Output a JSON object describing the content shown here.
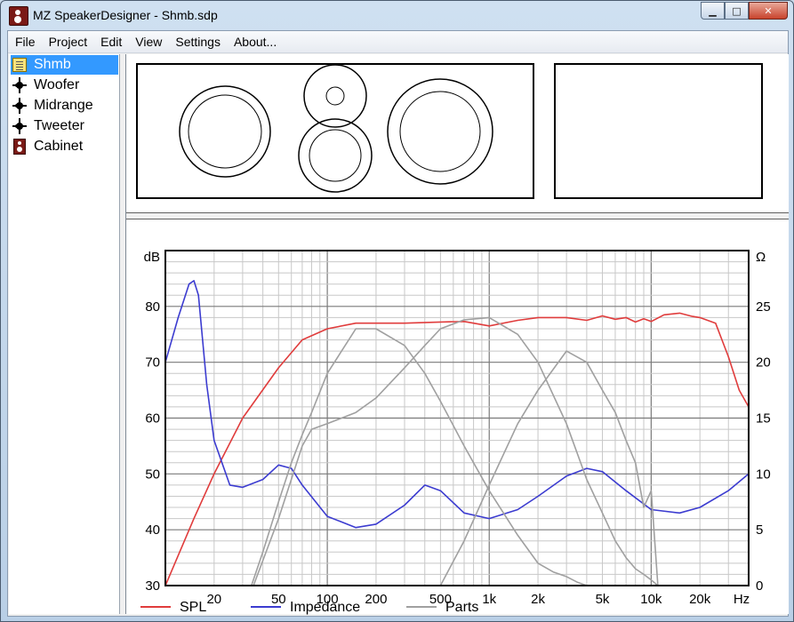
{
  "window": {
    "title": "MZ SpeakerDesigner - Shmb.sdp",
    "buttons": {
      "minimize": "▁",
      "maximize": "□",
      "close": "✕"
    }
  },
  "menu": [
    "File",
    "Project",
    "Edit",
    "View",
    "Settings",
    "About..."
  ],
  "tree": [
    {
      "label": "Shmb",
      "icon": "project-icon",
      "selected": true
    },
    {
      "label": "Woofer",
      "icon": "driver-icon",
      "selected": false
    },
    {
      "label": "Midrange",
      "icon": "driver-icon",
      "selected": false
    },
    {
      "label": "Tweeter",
      "icon": "driver-icon",
      "selected": false
    },
    {
      "label": "Cabinet",
      "icon": "cabinet-icon",
      "selected": false
    }
  ],
  "chart_data": {
    "type": "line",
    "x_scale": "log",
    "xlim": [
      10,
      40000
    ],
    "ylim_left": [
      30,
      90
    ],
    "ylim_right": [
      0,
      30
    ],
    "ylabel_left": "dB",
    "ylabel_right": "Ω",
    "xlabel": "Hz",
    "x_ticks": [
      {
        "value": 20,
        "label": "20"
      },
      {
        "value": 50,
        "label": "50"
      },
      {
        "value": 100,
        "label": "100"
      },
      {
        "value": 200,
        "label": "200"
      },
      {
        "value": 500,
        "label": "500"
      },
      {
        "value": 1000,
        "label": "1k"
      },
      {
        "value": 2000,
        "label": "2k"
      },
      {
        "value": 5000,
        "label": "5k"
      },
      {
        "value": 10000,
        "label": "10k"
      },
      {
        "value": 20000,
        "label": "20k"
      }
    ],
    "y_ticks_left": [
      30,
      40,
      50,
      60,
      70,
      80
    ],
    "y_ticks_right": [
      0,
      5,
      10,
      15,
      20,
      25
    ],
    "grid": true,
    "legend": [
      {
        "name": "SPL",
        "color": "#e03c3c"
      },
      {
        "name": "Impedance",
        "color": "#3c3cd0"
      },
      {
        "name": "Parts",
        "color": "#a0a0a0"
      }
    ],
    "series": [
      {
        "name": "SPL",
        "axis": "left",
        "color": "#e03c3c",
        "x": [
          10,
          15,
          20,
          30,
          50,
          70,
          100,
          150,
          200,
          300,
          500,
          700,
          1000,
          1500,
          2000,
          3000,
          4000,
          5000,
          6000,
          7000,
          8000,
          9000,
          10000,
          12000,
          15000,
          18000,
          20000,
          25000,
          30000,
          35000,
          40000
        ],
        "y": [
          30,
          42,
          50,
          60,
          69,
          74,
          76,
          77,
          77,
          77,
          77.2,
          77.3,
          76.5,
          77.5,
          78,
          78,
          77.5,
          78.3,
          77.7,
          78,
          77.2,
          77.8,
          77.3,
          78.5,
          78.8,
          78.2,
          78,
          77,
          71,
          65,
          62
        ]
      },
      {
        "name": "Impedance",
        "axis": "right",
        "color": "#3c3cd0",
        "x": [
          10,
          12,
          14,
          15,
          16,
          18,
          20,
          25,
          30,
          40,
          50,
          60,
          70,
          100,
          150,
          200,
          300,
          400,
          500,
          700,
          1000,
          1500,
          2000,
          3000,
          4000,
          5000,
          7000,
          10000,
          15000,
          20000,
          30000,
          40000
        ],
        "y": [
          20,
          24,
          27,
          27.3,
          26,
          18,
          13,
          9,
          8.8,
          9.5,
          10.8,
          10.5,
          9,
          6.2,
          5.2,
          5.5,
          7.2,
          9.0,
          8.5,
          6.5,
          6.0,
          6.8,
          8.0,
          9.8,
          10.5,
          10.2,
          8.5,
          6.8,
          6.5,
          7.0,
          8.5,
          10
        ]
      },
      {
        "name": "Parts",
        "axis": "right",
        "color": "#a0a0a0",
        "x": [
          34,
          40,
          50,
          60,
          70,
          80,
          100,
          150,
          200,
          300,
          400,
          500,
          700,
          1000,
          1500,
          2000,
          2500,
          3000,
          3500,
          4000
        ],
        "y": [
          0,
          3,
          7.5,
          11,
          13.5,
          15.5,
          19,
          23,
          23,
          21.5,
          19,
          16.5,
          12.5,
          8.5,
          4.5,
          2,
          1.2,
          0.8,
          0.3,
          0
        ]
      },
      {
        "name": "Parts",
        "axis": "right",
        "color": "#a0a0a0",
        "x": [
          35,
          50,
          70,
          80,
          100,
          150,
          200,
          300,
          400,
          500,
          700,
          1000,
          1500,
          2000,
          3000,
          4000,
          5000,
          6000,
          7000,
          8000,
          9000,
          10000,
          11000
        ],
        "y": [
          0,
          6,
          12.5,
          14,
          14.5,
          15.5,
          16.8,
          19.5,
          21.5,
          23,
          23.8,
          24,
          22.5,
          20,
          14.5,
          9.5,
          6.5,
          4,
          2.5,
          1.5,
          1,
          0.5,
          0
        ]
      },
      {
        "name": "Parts",
        "axis": "right",
        "color": "#a0a0a0",
        "x": [
          500,
          700,
          1000,
          1500,
          2000,
          3000,
          4000,
          5000,
          6000,
          7000,
          8000,
          9000,
          10000,
          11000
        ],
        "y": [
          0,
          4,
          9,
          14.5,
          17.5,
          21,
          20,
          17.5,
          15.5,
          13,
          11,
          7,
          8.5,
          0
        ]
      }
    ]
  }
}
